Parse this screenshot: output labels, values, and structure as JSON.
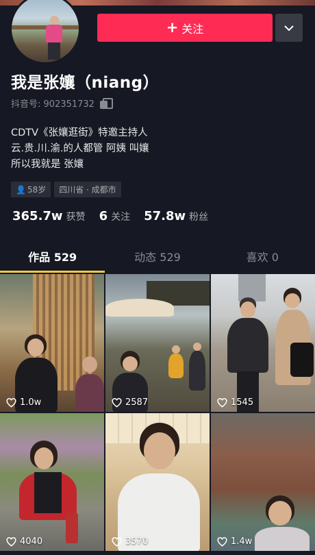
{
  "profile": {
    "follow_label": "关注",
    "follow_plus": "+",
    "nickname": "我是张孃（niang）",
    "douyin_id": "抖音号: 902351732",
    "bio_lines": [
      "CDTV《张孃逛街》特邀主持人",
      "云.贵.川.渝.的人都管 阿姨 叫孃",
      "所以我就是 张孃"
    ],
    "tags": {
      "age": "58岁",
      "location": "四川省 · 成都市"
    },
    "stats": [
      {
        "value": "365.7w",
        "label": "获赞"
      },
      {
        "value": "6",
        "label": "关注"
      },
      {
        "value": "57.8w",
        "label": "粉丝"
      }
    ]
  },
  "tabs": [
    {
      "label": "作品 529",
      "active": true
    },
    {
      "label": "动态 529",
      "active": false
    },
    {
      "label": "喜欢 0",
      "active": false
    }
  ],
  "videos": [
    {
      "likes": "1.0w"
    },
    {
      "likes": "2587"
    },
    {
      "likes": "1545"
    },
    {
      "likes": "4040"
    },
    {
      "likes": "3570"
    },
    {
      "likes": "1.4w"
    }
  ],
  "colors": {
    "background": "#161823",
    "follow_button": "#fe2c55",
    "tab_indicator": "#facc3c",
    "secondary_text": "#8a8b91"
  },
  "icons": {
    "more": "chevron-down-icon",
    "copy": "copy-icon",
    "gender": "female-icon",
    "like": "heart-icon"
  }
}
